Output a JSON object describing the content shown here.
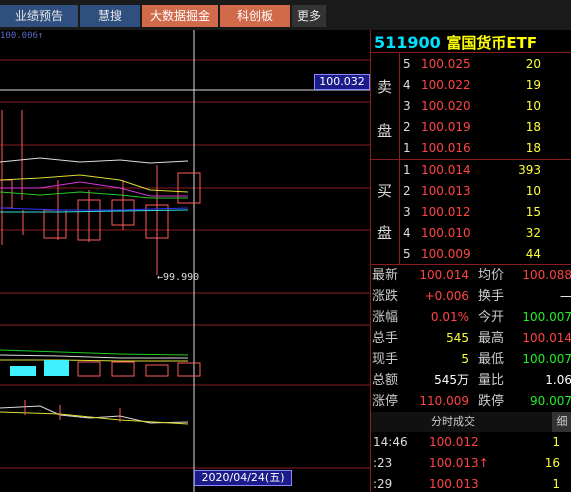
{
  "tabs": [
    {
      "label": "业绩预告"
    },
    {
      "label": "慧搜"
    },
    {
      "label": "大数据掘金"
    },
    {
      "label": "科创板"
    },
    {
      "label": "更多"
    }
  ],
  "chart": {
    "top_label": "100.006↑",
    "price_tag": "100.032",
    "low_label": "←99.990",
    "date_label": "2020/04/24(五)"
  },
  "stock": {
    "code": "511900",
    "name": "富国货币ETF"
  },
  "orderbook": {
    "sell_label_1": "卖",
    "sell_label_2": "盘",
    "buy_label_1": "买",
    "buy_label_2": "盘",
    "sell": [
      {
        "level": "5",
        "price": "100.025",
        "volume": "20"
      },
      {
        "level": "4",
        "price": "100.022",
        "volume": "19"
      },
      {
        "level": "3",
        "price": "100.020",
        "volume": "10"
      },
      {
        "level": "2",
        "price": "100.019",
        "volume": "18"
      },
      {
        "level": "1",
        "price": "100.016",
        "volume": "18"
      }
    ],
    "buy": [
      {
        "level": "1",
        "price": "100.014",
        "volume": "393"
      },
      {
        "level": "2",
        "price": "100.013",
        "volume": "10"
      },
      {
        "level": "3",
        "price": "100.012",
        "volume": "15"
      },
      {
        "level": "4",
        "price": "100.010",
        "volume": "32"
      },
      {
        "level": "5",
        "price": "100.009",
        "volume": "44"
      }
    ]
  },
  "quote": [
    {
      "l1": "最新",
      "v1": "100.014",
      "c1": "red",
      "l2": "均价",
      "v2": "100.088",
      "c2": "red"
    },
    {
      "l1": "涨跌",
      "v1": "+0.006",
      "c1": "red",
      "l2": "换手",
      "v2": "—",
      "c2": "white"
    },
    {
      "l1": "涨幅",
      "v1": "0.01%",
      "c1": "red",
      "l2": "今开",
      "v2": "100.007",
      "c2": "green"
    },
    {
      "l1": "总手",
      "v1": "545",
      "c1": "yellow",
      "l2": "最高",
      "v2": "100.014",
      "c2": "red"
    },
    {
      "l1": "现手",
      "v1": "5",
      "c1": "yellow",
      "l2": "最低",
      "v2": "100.007",
      "c2": "green"
    },
    {
      "l1": "总额",
      "v1": "545万",
      "c1": "white",
      "l2": "量比",
      "v2": "1.06",
      "c2": "white"
    },
    {
      "l1": "涨停",
      "v1": "110.009",
      "c1": "red",
      "l2": "跌停",
      "v2": "90.007",
      "c2": "green"
    }
  ],
  "ticks": {
    "title": "分时成交",
    "more": "细",
    "rows": [
      {
        "time": "14:46",
        "price": "100.012",
        "arrow": "",
        "volume": "1"
      },
      {
        "time": ":23",
        "price": "100.013",
        "arrow": "🠙",
        "volume": "16"
      },
      {
        "time": ":29",
        "price": "100.013",
        "arrow": "",
        "volume": "1"
      }
    ]
  },
  "colors": {
    "up": "#ff4444",
    "down": "#22ee22",
    "volume": "#ffff3a",
    "grid": "#8a1e1e",
    "code": "#00e0ff",
    "tab_blue": "#2f4f7f",
    "tab_orange": "#d06a4a"
  }
}
